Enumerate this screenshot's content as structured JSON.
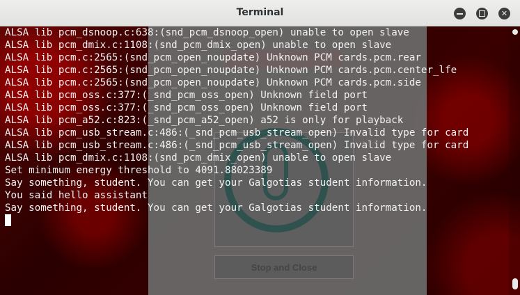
{
  "window": {
    "title": "Terminal"
  },
  "controls": {
    "minimize_icon": "minimize-icon",
    "maximize_icon": "maximize-icon",
    "close_icon": "close-icon",
    "close_glyph": "✕"
  },
  "background_app": {
    "stop_button_label": "Stop and Close",
    "mic_icon": "microphone-icon"
  },
  "terminal": {
    "lines": [
      "ALSA lib pcm_dsnoop.c:638:(snd_pcm_dsnoop_open) unable to open slave",
      "ALSA lib pcm_dmix.c:1108:(snd_pcm_dmix_open) unable to open slave",
      "ALSA lib pcm.c:2565:(snd_pcm_open_noupdate) Unknown PCM cards.pcm.rear",
      "ALSA lib pcm.c:2565:(snd_pcm_open_noupdate) Unknown PCM cards.pcm.center_lfe",
      "ALSA lib pcm.c:2565:(snd_pcm_open_noupdate) Unknown PCM cards.pcm.side",
      "ALSA lib pcm_oss.c:377:(_snd_pcm_oss_open) Unknown field port",
      "ALSA lib pcm_oss.c:377:(_snd_pcm_oss_open) Unknown field port",
      "ALSA lib pcm_a52.c:823:(_snd_pcm_a52_open) a52 is only for playback",
      "ALSA lib pcm_usb_stream.c:486:(_snd_pcm_usb_stream_open) Invalid type for card",
      "ALSA lib pcm_usb_stream.c:486:(_snd_pcm_usb_stream_open) Invalid type for card",
      "ALSA lib pcm_dmix.c:1108:(snd_pcm_dmix_open) unable to open slave",
      "Set minimum energy threshold to 4091.88023389",
      "Say something, student. You can get your Galgotias student information.",
      "You said hello assistant",
      "Say something, student. You can get your Galgotias student information."
    ]
  },
  "colors": {
    "titlebar_bg": "#e8e8e7",
    "terminal_text": "#f2f2f2",
    "background": "#4a0000"
  }
}
